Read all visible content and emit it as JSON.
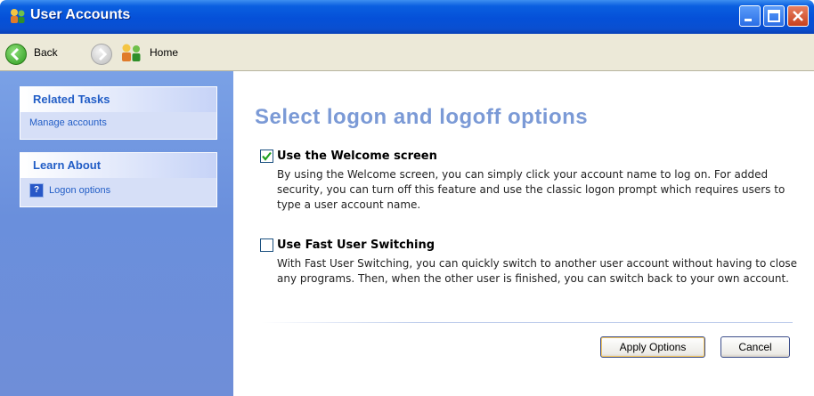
{
  "window": {
    "title": "User Accounts"
  },
  "toolbar": {
    "back_label": "Back",
    "home_label": "Home"
  },
  "sidebar": {
    "related_tasks": {
      "heading": "Related Tasks",
      "items": [
        "Manage accounts"
      ]
    },
    "learn_about": {
      "heading": "Learn About",
      "items": [
        "Logon options"
      ]
    }
  },
  "main": {
    "heading": "Select logon and logoff options",
    "options": [
      {
        "title": "Use the Welcome screen",
        "checked": true,
        "description": "By using the Welcome screen, you can simply click your account name to log on. For added security, you can turn off this feature and use the classic logon prompt which requires users to type a user account name."
      },
      {
        "title": "Use Fast User Switching",
        "checked": false,
        "description": "With Fast User Switching, you can quickly switch to another user account without having to close any programs. Then, when the other user is finished, you can switch back to your own account."
      }
    ],
    "apply_label": "Apply Options",
    "cancel_label": "Cancel"
  },
  "icons": {
    "title": "user-accounts-icon",
    "back": "back-arrow-icon",
    "forward": "forward-arrow-icon",
    "home": "home-icon",
    "help": "help-icon",
    "check": "checkmark-icon"
  },
  "colors": {
    "titlebar": "#0550d8",
    "sidebar": "#6f8ed8",
    "heading": "#7b9ad6",
    "link": "#215dc6"
  }
}
